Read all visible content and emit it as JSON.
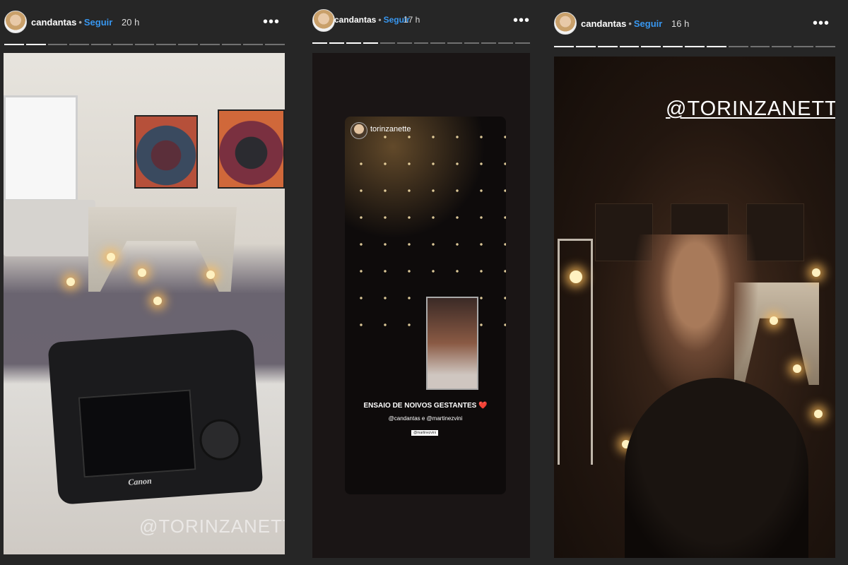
{
  "stories": [
    {
      "username": "candantas",
      "follow_label": "Seguir",
      "time": "20 h",
      "more_label": "•••",
      "watermark": "@TORINZANETTE",
      "camera_brand": "Canon",
      "progress": {
        "segments": 13,
        "current": 2
      }
    },
    {
      "username": "candantas",
      "follow_label": "Seguir",
      "time": "17 h",
      "more_label": "•••",
      "progress": {
        "segments": 13,
        "current": 4
      },
      "embedded": {
        "username": "torinzanette",
        "caption": "ENSAIO DE NOIVOS GESTANTES",
        "caption_emoji": "❤️",
        "mentions": "@candantas e @martinezvini",
        "subtag": "@martinezvini"
      }
    },
    {
      "username": "candantas",
      "follow_label": "Seguir",
      "time": "16 h",
      "more_label": "•••",
      "watermark": "@TORINZANETTE",
      "progress": {
        "segments": 13,
        "current": 8
      }
    }
  ],
  "separator_dot": "•",
  "colors": {
    "background": "#262626",
    "follow": "#3897f0",
    "heart": "#e02b2b"
  }
}
